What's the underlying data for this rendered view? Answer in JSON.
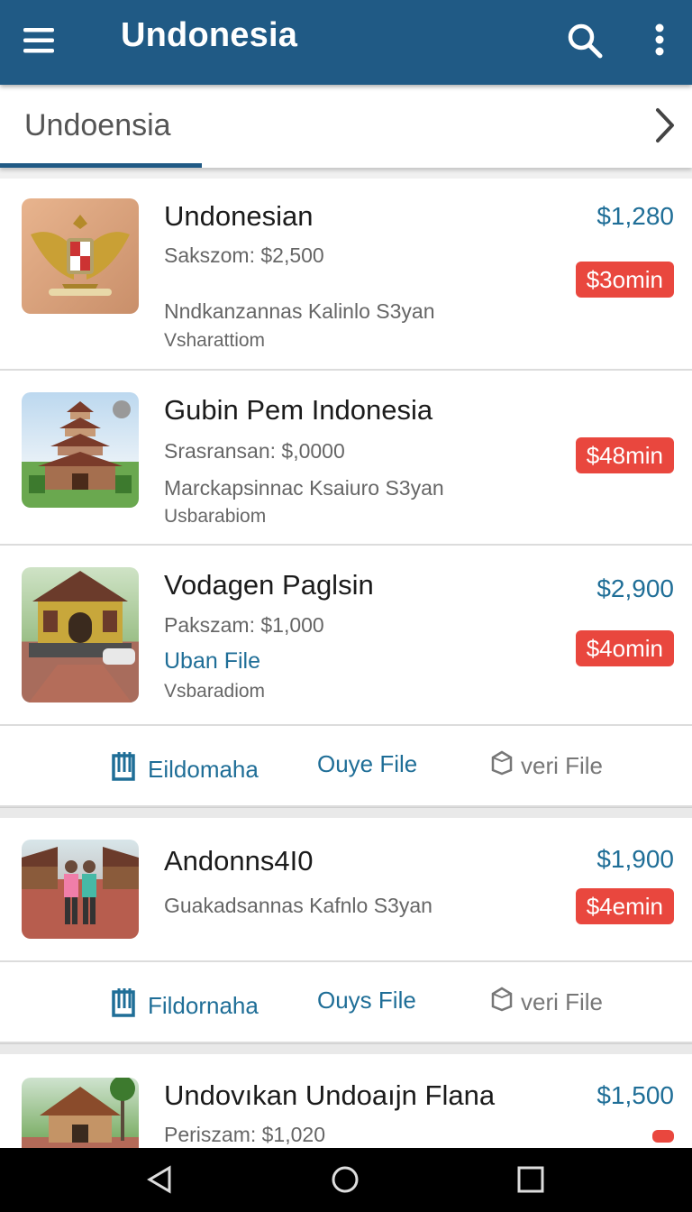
{
  "appbar": {
    "title": "Undonesia",
    "menu_icon": "menu-icon",
    "search_icon": "search-icon",
    "more_icon": "more-vert-icon",
    "color": "#205a85"
  },
  "tabs": {
    "active_label": "Undoensia",
    "next_icon": "chevron-right-icon"
  },
  "listings": [
    {
      "name": "Undonesian",
      "price": "$1,280",
      "line1": "Sakszom: $2,500",
      "line2": "Nndkanzannas Kalinlo S3yan",
      "line3": "Vsharattiom",
      "badge": "$3omin",
      "image": "garuda-emblem"
    },
    {
      "name": "Gubin Pem Indonesia",
      "price": "",
      "line1": "Srasransan: $,0000",
      "line2": "Marckapsinnac Ksaiuro S3yan",
      "line3": "Usbarabiom",
      "badge": "$48min",
      "image": "pagoda-temple"
    },
    {
      "name": "Vodagen Paglsin",
      "price": "$2,900",
      "line1": "Pakszam: $1,000",
      "line2": "Uban File",
      "line3": "Vsbaradiom",
      "badge": "$4omin",
      "image": "yellow-temple"
    },
    {
      "name": "Andonns4I0",
      "price": "$1,900",
      "line1": "Guakadsannas Kafnlo S3yan",
      "badge": "$4emin",
      "image": "people-at-temple"
    },
    {
      "name": "Undovıkan Undoaıjn Flana",
      "price": "$1,500",
      "line1": "Periszam: $1,020",
      "image": "palm-house"
    }
  ],
  "actions": [
    {
      "a": "Eildomaha",
      "b": "Ouye File",
      "c": "veri File"
    },
    {
      "a": "Fildornaha",
      "b": "Ouys File",
      "c": "veri File"
    }
  ],
  "colors": {
    "accent": "#1f6e97",
    "badge": "#e9473e"
  },
  "system_nav": {
    "back_icon": "back-triangle-icon",
    "home_icon": "home-circle-icon",
    "recents_icon": "recents-square-icon"
  }
}
